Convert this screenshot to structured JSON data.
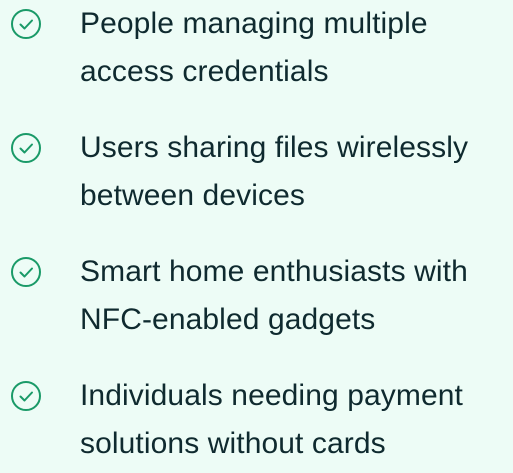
{
  "checklist": {
    "items": [
      {
        "icon": "check-circle-icon",
        "line1": "People managing multiple",
        "line2": "access credentials"
      },
      {
        "icon": "check-circle-icon",
        "line1": "Users sharing files wirelessly",
        "line2": "between devices"
      },
      {
        "icon": "check-circle-icon",
        "line1": "Smart home enthusiasts with",
        "line2": "NFC-enabled gadgets"
      },
      {
        "icon": "check-circle-icon",
        "line1": "Individuals needing payment",
        "line2": "solutions without cards"
      }
    ]
  },
  "colors": {
    "background": "#edfcf6",
    "accent": "#1a9a68",
    "text": "#0f2a2f"
  }
}
